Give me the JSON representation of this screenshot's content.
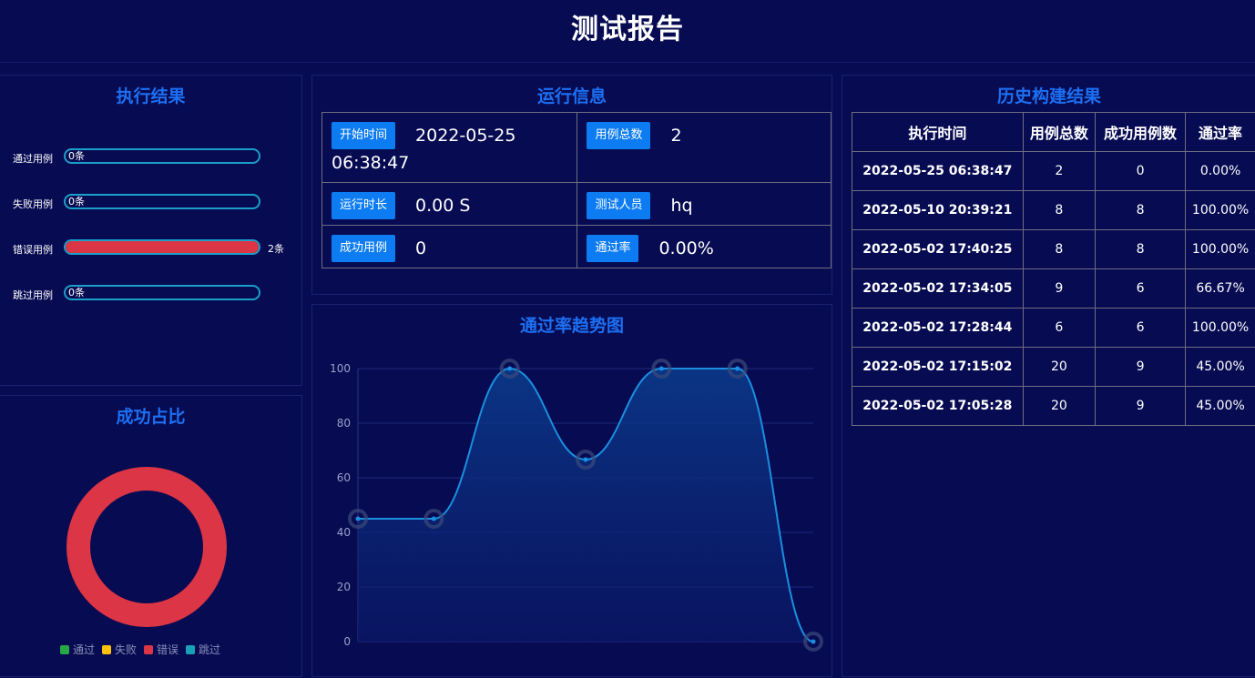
{
  "page": {
    "title": "测试报告"
  },
  "execution": {
    "title": "执行结果",
    "rows": [
      {
        "label": "通过用例",
        "inner": "0条",
        "after": "",
        "fraction": 0
      },
      {
        "label": "失败用例",
        "inner": "0条",
        "after": "",
        "fraction": 0
      },
      {
        "label": "错误用例",
        "inner": "",
        "after": "2条",
        "fraction": 1
      },
      {
        "label": "跳过用例",
        "inner": "0条",
        "after": "",
        "fraction": 0
      }
    ]
  },
  "run_info": {
    "title": "运行信息",
    "start_time": {
      "label": "开始时间",
      "value": "2022-05-25 06:38:47"
    },
    "case_total": {
      "label": "用例总数",
      "value": "2"
    },
    "duration": {
      "label": "运行时长",
      "value": "0.00 S"
    },
    "tester": {
      "label": "测试人员",
      "value": "hq"
    },
    "success": {
      "label": "成功用例",
      "value": "0"
    },
    "pass_rate": {
      "label": "通过率",
      "value": "0.00%"
    }
  },
  "history": {
    "title": "历史构建结果",
    "headers": [
      "执行时间",
      "用例总数",
      "成功用例数",
      "通过率"
    ],
    "rows": [
      [
        "2022-05-25 06:38:47",
        "2",
        "0",
        "0.00%"
      ],
      [
        "2022-05-10 20:39:21",
        "8",
        "8",
        "100.00%"
      ],
      [
        "2022-05-02 17:40:25",
        "8",
        "8",
        "100.00%"
      ],
      [
        "2022-05-02 17:34:05",
        "9",
        "6",
        "66.67%"
      ],
      [
        "2022-05-02 17:28:44",
        "6",
        "6",
        "100.00%"
      ],
      [
        "2022-05-02 17:15:02",
        "20",
        "9",
        "45.00%"
      ],
      [
        "2022-05-02 17:05:28",
        "20",
        "9",
        "45.00%"
      ]
    ]
  },
  "success_ratio": {
    "title": "成功占比",
    "legend": [
      "通过",
      "失败",
      "错误",
      "跳过"
    ],
    "values": [
      0,
      0,
      2,
      0
    ],
    "colors": [
      "#28a745",
      "#ffc107",
      "#dc3545",
      "#17a2b8"
    ]
  },
  "chart_data": {
    "type": "line",
    "title": "通过率趋势图",
    "xlabel": "",
    "ylabel": "",
    "ylim": [
      0,
      100
    ],
    "yticks": [
      "0",
      "20",
      "40",
      "60",
      "80",
      "100"
    ],
    "series": [
      {
        "values": [
          45,
          45,
          100,
          66.67,
          100,
          100,
          0
        ]
      }
    ],
    "smooth": true,
    "area": true,
    "grid": true,
    "color": "#1a8fe0"
  }
}
